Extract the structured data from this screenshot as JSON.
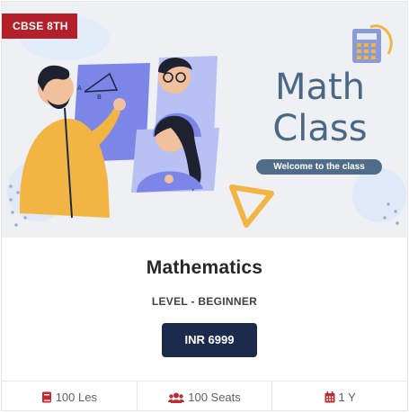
{
  "badge": "CBSE 8TH",
  "banner": {
    "title_line1": "Math",
    "title_line2": "Class",
    "subtitle": "Welcome to the class",
    "colors": {
      "title": "#4a6886",
      "pill": "#4f6d8b",
      "badge": "#b3202a",
      "accent_yellow": "#f2b544",
      "accent_purple": "#7b86e8"
    }
  },
  "course": {
    "title": "Mathematics",
    "level": "LEVEL - BEGINNER",
    "price_button": "INR 6999"
  },
  "footer": {
    "lessons": {
      "icon": "book-icon",
      "label": "100 Les"
    },
    "seats": {
      "icon": "users-icon",
      "label": "100 Seats"
    },
    "duration": {
      "icon": "calendar-icon",
      "label": "1 Y"
    }
  }
}
